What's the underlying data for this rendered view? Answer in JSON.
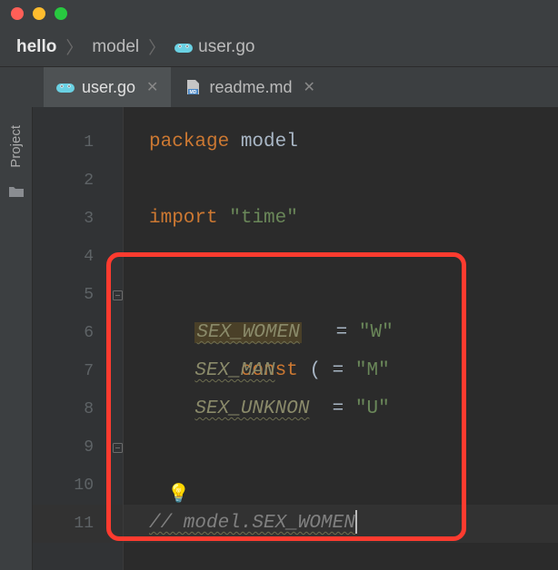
{
  "breadcrumbs": {
    "root": "hello",
    "folder": "model",
    "file": "user.go"
  },
  "tabs": [
    {
      "label": "user.go",
      "active": true,
      "kind": "go"
    },
    {
      "label": "readme.md",
      "active": false,
      "kind": "md"
    }
  ],
  "toolwindow": {
    "label": "Project"
  },
  "gutter": {
    "lines": [
      "1",
      "2",
      "3",
      "4",
      "5",
      "6",
      "7",
      "8",
      "9",
      "10",
      "11"
    ]
  },
  "code": {
    "l1": {
      "kw": "package",
      "name": "model"
    },
    "l3": {
      "kw": "import",
      "str": "\"time\""
    },
    "l5": {
      "kw": "const",
      "paren": "("
    },
    "l6": {
      "id": "SEX_WOMEN",
      "eq": "=",
      "val": "\"W\""
    },
    "l7": {
      "id": "SEX_MAN",
      "eq": "=",
      "val": "\"M\""
    },
    "l8": {
      "id": "SEX_UNKNON",
      "eq": "=",
      "val": "\"U\""
    },
    "l9": {
      "paren": ")"
    },
    "l11": {
      "comment": "// model.SEX_WOMEN"
    }
  },
  "icons": {
    "bulb": "💡"
  }
}
